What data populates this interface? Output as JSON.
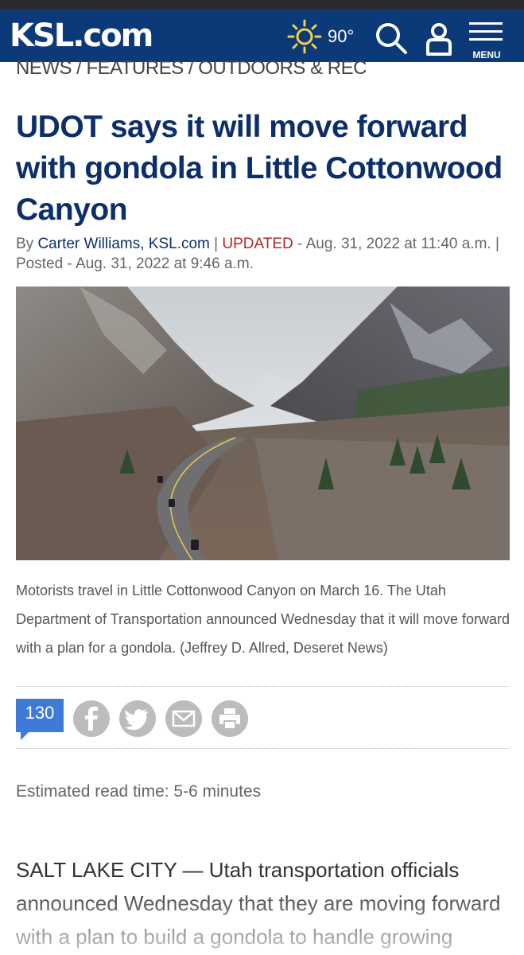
{
  "header": {
    "logo": "KSL.com",
    "temperature": "90°",
    "weather_icon": "sun-icon",
    "menu_label": "MENU",
    "brand_color": "#0c3a78"
  },
  "breadcrumb": "NEWS / FEATURES / OUTDOORS & REC",
  "article": {
    "title": "UDOT says it will move forward with gondola in Little Cottonwood Canyon",
    "byline_prefix": "By ",
    "author": "Carter Williams, KSL.com",
    "sep1": " | ",
    "updated_label": "UPDATED",
    "updated_text": " - Aug. 31, 2022 at 11:40 a.m. | Posted - Aug. 31, 2022 at 9:46 a.m.",
    "caption": "Motorists travel in Little Cottonwood Canyon on March 16. The Utah Department of Transportation announced Wednesday that it will move forward with a plan for a gondola. (Jeffrey D. Allred, Deseret News)",
    "read_time": "Estimated read time: 5-6 minutes",
    "body_lead": "SALT LAKE CITY — Utah transportation officials announced Wednesday that they are moving forward with a plan to build a gondola to handle growing"
  },
  "share": {
    "comment_count": "130",
    "icons": [
      "facebook-icon",
      "twitter-icon",
      "email-icon",
      "print-icon"
    ]
  }
}
